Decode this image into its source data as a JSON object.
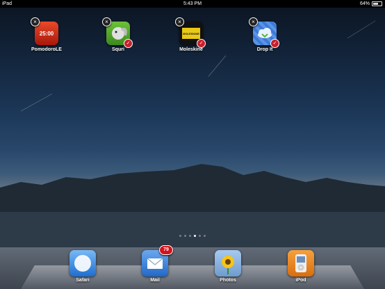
{
  "status": {
    "device": "iPad",
    "time": "5:43 PM",
    "battery": "64%",
    "battery_level": 0.64
  },
  "home_apps": [
    {
      "label": "PomodoroLE",
      "icon": "tomato-timer-icon",
      "icon_text": "25:00"
    },
    {
      "label": "Squri",
      "icon": "squirrel-icon"
    },
    {
      "label": "Moleskine",
      "icon": "moleskine-notebook-icon",
      "icon_text": "MOLESKINE"
    },
    {
      "label": "Drop It",
      "icon": "cloud-icon"
    }
  ],
  "page_indicator": {
    "count": 6,
    "active": 4
  },
  "dock": [
    {
      "label": "Safari",
      "icon": "compass-icon"
    },
    {
      "label": "Mail",
      "icon": "envelope-icon",
      "badge": "79"
    },
    {
      "label": "Photos",
      "icon": "sunflower-icon"
    },
    {
      "label": "iPod",
      "icon": "ipod-icon"
    }
  ]
}
